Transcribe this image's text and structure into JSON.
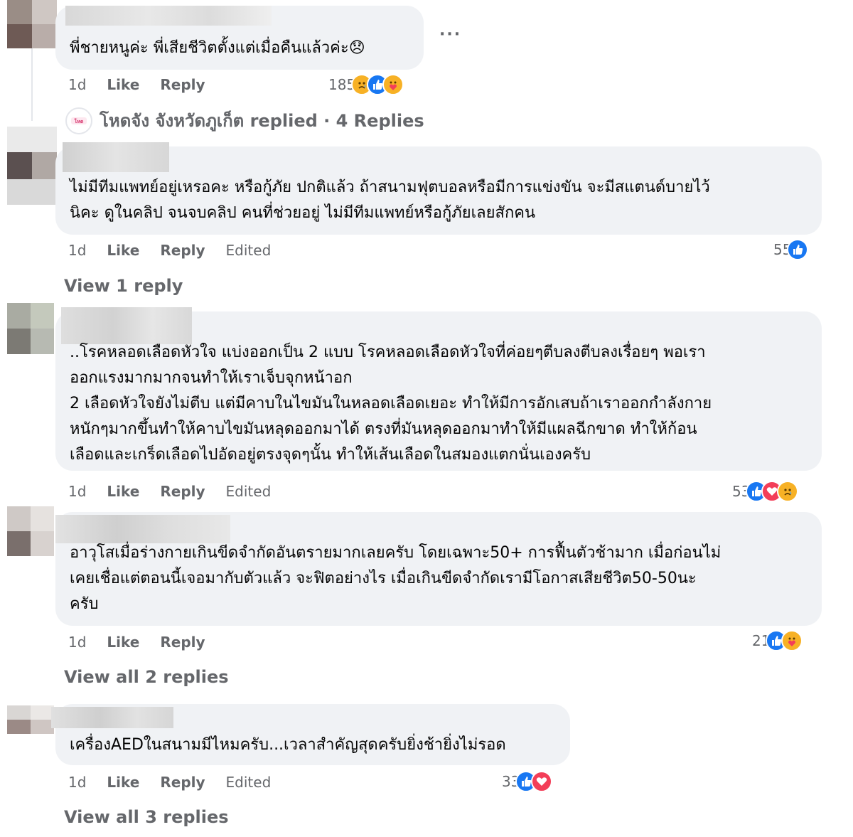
{
  "colors": {
    "bubble_bg": "#f0f2f5",
    "meta_text": "#65676b",
    "like_blue": "#1877f2",
    "love_red": "#f33e58",
    "care_yellow": "#f7b125"
  },
  "comments": [
    {
      "lines": [
        "พี่ชายหนูค่ะ พี่เสียชีวิตตั้งแต่เมื่อคืนแล้วค่ะ😞"
      ],
      "time": "1d",
      "like": "Like",
      "reply": "Reply",
      "edited": "",
      "reaction_count": "185",
      "reaction_icons": [
        "sad-icon",
        "like-icon",
        "care-icon"
      ],
      "more": "···"
    },
    {
      "lines": [
        "ไม่มีทีมแพทย์อยู่เหรอคะ หรือกู้ภัย ปกติแล้ว ถ้าสนามฟุตบอลหรือมีการแข่งขัน จะมีสแตนด์บายไว้",
        "นิคะ ดูในคลิป จนจบคลิป คนที่ช่วยอยู่ ไม่มีทีมแพทย์หรือกู้ภัยเลยสักคน"
      ],
      "time": "1d",
      "like": "Like",
      "reply": "Reply",
      "edited": "Edited",
      "reaction_count": "55",
      "reaction_icons": [
        "like-icon"
      ]
    },
    {
      "lines": [
        "..โรคหลอดเลือดหัวใจ แบ่งออกเป็น 2 แบบ โรคหลอดเลือดหัวใจที่ค่อยๆตีบลงตีบลงเรื่อยๆ พอเรา",
        "ออกแรงมากมากจนทำให้เราเจ็บจุกหน้าอก",
        "2 เลือดหัวใจยังไม่ตีบ แต่มีคาบในไขมันในหลอดเลือดเยอะ ทำให้มีการอักเสบถ้าเราออกกำลังกาย",
        "หนักๆมากขึ้นทำให้คาบไขมันหลุดออกมาได้ ตรงที่มันหลุดออกมาทำให้มีแผลฉีกขาด ทำให้ก้อน",
        "เลือดและเกร็ดเลือดไปอัดอยู่ตรงจุดๆนั้น ทำให้เส้นเลือดในสมองแตกนั่นเองครับ"
      ],
      "time": "1d",
      "like": "Like",
      "reply": "Reply",
      "edited": "Edited",
      "reaction_count": "53",
      "reaction_icons": [
        "like-icon",
        "love-icon",
        "sad-icon"
      ]
    },
    {
      "lines": [
        "อาวุโสเมื่อร่างกายเกินขีดจำกัดอันตรายมากเลยครับ โดยเฉพาะ50+ การฟื้นตัวช้ามาก เมื่อก่อนไม่",
        "เคยเชื่อแต่ตอนนี้เจอมากับตัวแล้ว จะฟิตอย่างไร เมื่อเกินขีดจำกัดเรามีโอกาสเสียชีวิต50-50นะ",
        "ครับ"
      ],
      "time": "1d",
      "like": "Like",
      "reply": "Reply",
      "edited": "",
      "reaction_count": "21",
      "reaction_icons": [
        "like-icon",
        "care-icon"
      ]
    },
    {
      "lines": [
        "เครื่องAEDในสนามมีไหมครับ...เวลาสำคัญสุดครับยิ่งช้ายิ่งไม่รอด"
      ],
      "time": "1d",
      "like": "Like",
      "reply": "Reply",
      "edited": "Edited",
      "reaction_count": "33",
      "reaction_icons": [
        "like-icon",
        "love-icon"
      ]
    }
  ],
  "replied_row": {
    "page_icon": "page-avatar-icon",
    "text": "โหดจัง จังหวัดภูเก็ต replied · 4 Replies"
  },
  "view_replies": [
    "View 1 reply",
    "View all 2 replies",
    "View all 3 replies"
  ]
}
